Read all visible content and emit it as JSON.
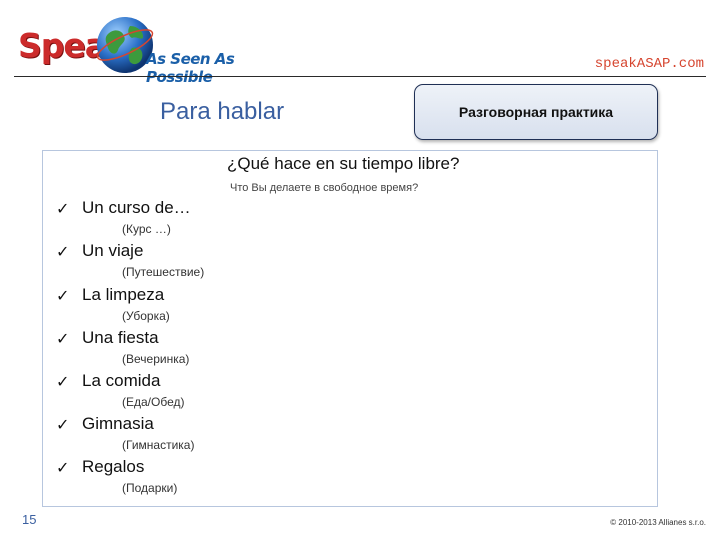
{
  "header": {
    "logo_main": "Speak",
    "logo_tagline": "As Seen As Possible",
    "site_url": "speakASAP.com"
  },
  "slide": {
    "title": "Para hablar",
    "tag": "Разговорная практика",
    "question": "¿Qué hace en su tiempo libre?",
    "question_translation": "Что Вы делаете в свободное время?"
  },
  "items": [
    {
      "label": "Un curso de…",
      "translation": "(Курс …)"
    },
    {
      "label": "Un viaje",
      "translation": "(Путешествие)"
    },
    {
      "label": "La limpeza",
      "translation": "(Уборка)"
    },
    {
      "label": "Una fiesta",
      "translation": "(Вечеринка)"
    },
    {
      "label": "La comida",
      "translation": "(Еда/Обед)"
    },
    {
      "label": "Gimnasia",
      "translation": "(Гимнастика)"
    },
    {
      "label": "Regalos",
      "translation": "(Подарки)"
    }
  ],
  "check_glyph": "✓",
  "footer": {
    "page_number": "15",
    "copyright": "© 2010-2013 Allianes s.r.o."
  },
  "colors": {
    "brand_red": "#cc2b2b",
    "brand_blue": "#1a5fa8",
    "title_blue": "#3a5fa0",
    "url_orange": "#d6452f"
  }
}
